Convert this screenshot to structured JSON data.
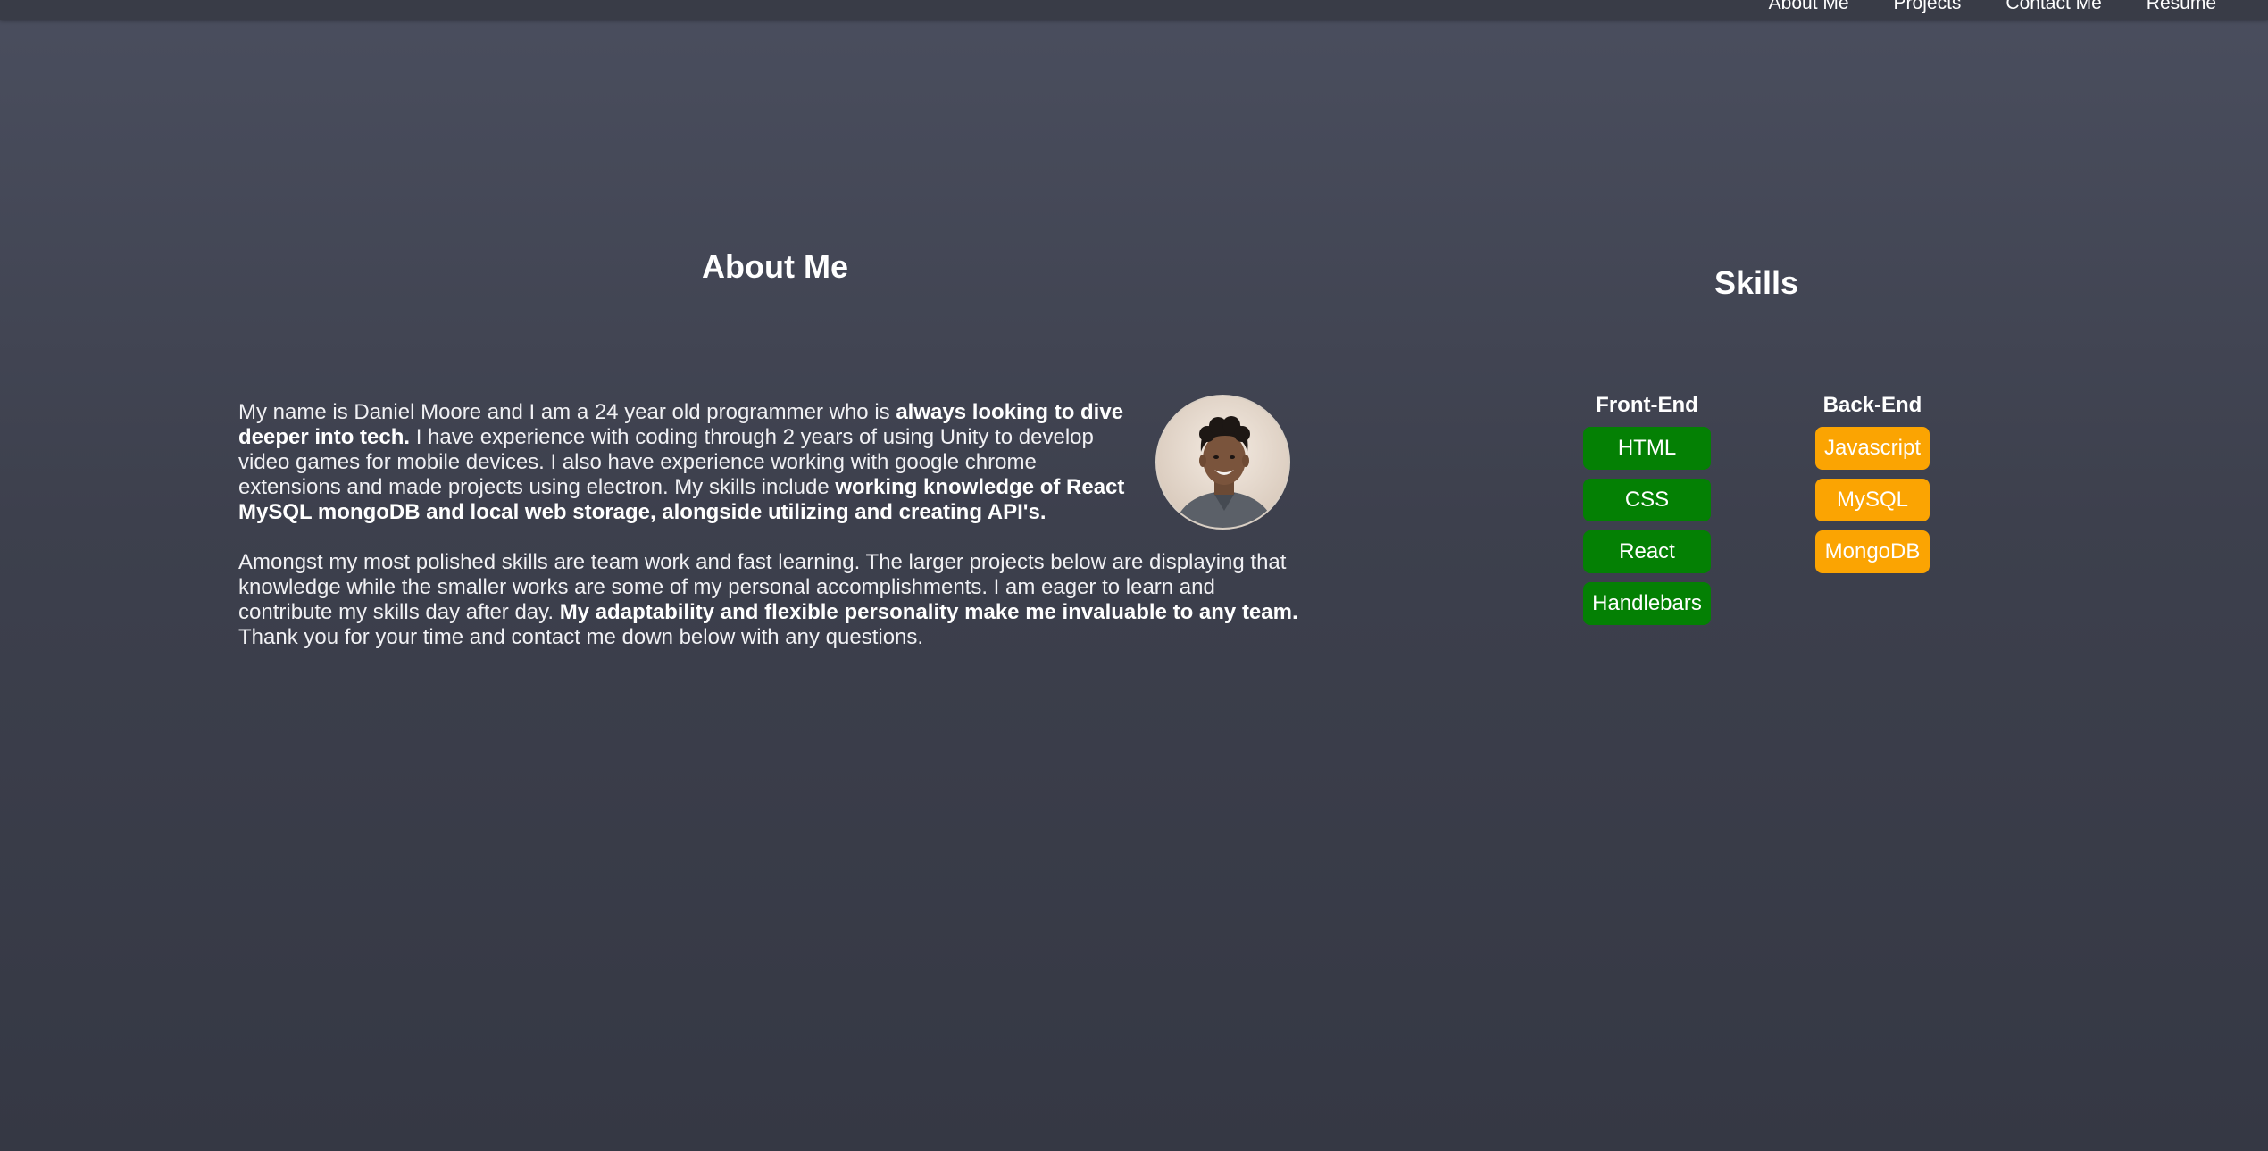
{
  "nav": {
    "items": [
      "About Me",
      "Projects",
      "Contact Me",
      "Resume"
    ]
  },
  "about": {
    "title": "About Me",
    "p1_a": "My name is Daniel Moore and I am a 24 year old programmer who is ",
    "p1_b": "always looking to dive deeper into tech.",
    "p1_c": " I have experience with coding through 2 years of using Unity to develop video games for mobile devices. I also have experience working with google chrome extensions and made projects using electron. My skills include ",
    "p1_d": "working knowledge of React MySQL mongoDB and local web storage, alongside utilizing and creating API's.",
    "p2_a": "Amongst my most polished skills are team work and fast learning. The larger projects below are displaying that knowledge while the smaller works are some of my personal accomplishments. I am eager to learn and contribute my skills day after day. ",
    "p2_b": "My adaptability and flexible personality make me invaluable to any team.",
    "p2_c": " Thank you for your time and contact me down below with any questions."
  },
  "skills": {
    "title": "Skills",
    "front_end": {
      "header": "Front-End",
      "items": [
        "HTML",
        "CSS",
        "React",
        "Handlebars"
      ]
    },
    "back_end": {
      "header": "Back-End",
      "items": [
        "Javascript",
        "MySQL",
        "MongoDB"
      ]
    }
  },
  "colors": {
    "front_end_pill": "#048004",
    "back_end_pill": "#fba402",
    "background": "#43465a"
  }
}
